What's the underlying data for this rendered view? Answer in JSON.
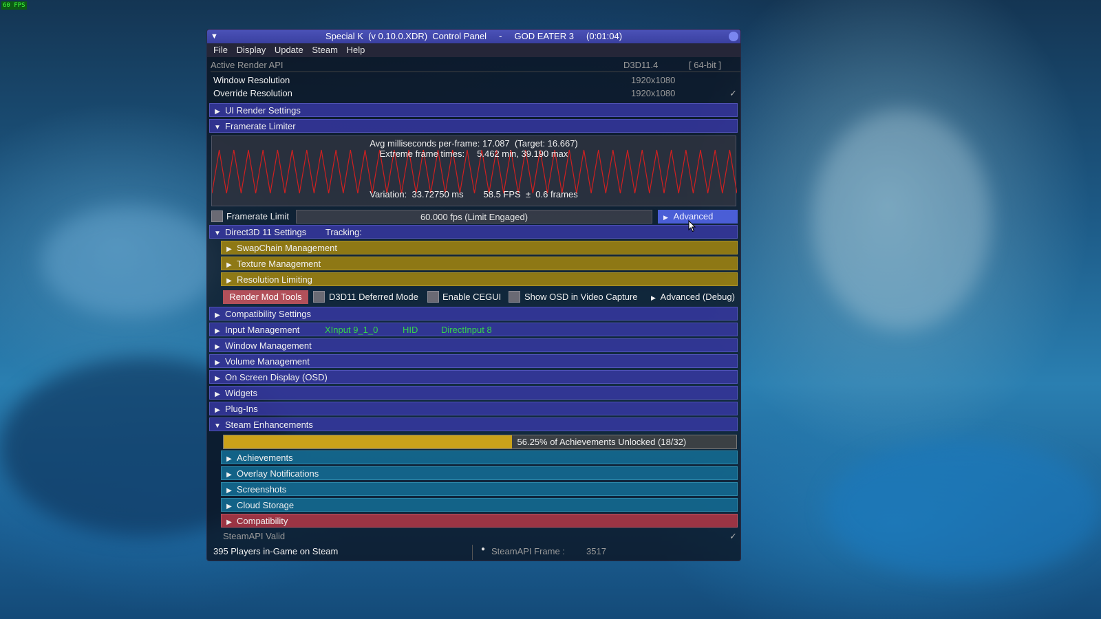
{
  "hud": {
    "fps": "60 FPS"
  },
  "window": {
    "title": "Special K  (v 0.10.0.XDR)  Control Panel     -     GOD EATER 3     (0:01:04)"
  },
  "menu": [
    "File",
    "Display",
    "Update",
    "Steam",
    "Help"
  ],
  "render_api": {
    "label": "Active Render API",
    "value": "D3D11.4",
    "bits": "[ 64-bit ]"
  },
  "window_resolution": {
    "label": "Window Resolution",
    "value": "1920x1080"
  },
  "override_resolution": {
    "label": "Override Resolution",
    "value": "1920x1080",
    "check": "✓"
  },
  "sections": {
    "ui_render": "UI Render Settings",
    "framerate_limiter": "Framerate Limiter",
    "d3d11": "Direct3D 11 Settings",
    "tracking": "Tracking:",
    "swapchain": "SwapChain Management",
    "texture": "Texture Management",
    "resolution_limiting": "Resolution Limiting",
    "compatibility_settings": "Compatibility Settings",
    "input_management": "Input Management",
    "window_management": "Window Management",
    "volume_management": "Volume Management",
    "osd": "On Screen Display (OSD)",
    "widgets": "Widgets",
    "plugins": "Plug-Ins",
    "steam_enhancements": "Steam Enhancements",
    "achievements": "Achievements",
    "overlay_notifications": "Overlay Notifications",
    "screenshots": "Screenshots",
    "cloud_storage": "Cloud Storage",
    "compatibility": "Compatibility"
  },
  "framegraph": {
    "line1": "Avg milliseconds per-frame: 17.087  (Target: 16.667)",
    "line2": "Extreme frame times:     5.462 min, 39.190 max",
    "line3": "Variation:  33.72750 ms        58.5 FPS  ±  0.6 frames",
    "line_color": "#d02020"
  },
  "framerate_limit": {
    "label": "Framerate Limit",
    "slider_text": "60.000 fps  (Limit Engaged)",
    "advanced": "Advanced"
  },
  "d3d11_options": {
    "render_mod_tools": "Render Mod Tools",
    "deferred": "D3D11 Deferred Mode",
    "cegui": "Enable CEGUI",
    "osd_capture": "Show OSD in Video Capture",
    "advanced_debug": "Advanced (Debug)"
  },
  "input_apis": [
    "XInput 9_1_0",
    "HID",
    "DirectInput 8"
  ],
  "achievements": {
    "progress_text": "56.25% of Achievements Unlocked (18/32)",
    "unlocked": 18,
    "total": 32,
    "fraction": 0.5625
  },
  "steamapi": {
    "label": "SteamAPI Valid",
    "check": "✓"
  },
  "footer": {
    "players": "395 Players in-Game on Steam",
    "frame_label": "SteamAPI Frame :",
    "frame_value": "3517"
  },
  "colors": {
    "header_blue": "#3a3aaa",
    "header_gold": "#a5870f",
    "header_teal": "#146e96",
    "header_red": "#af3746",
    "input_green": "#35d54a",
    "achievement_fill": "#caa21a"
  }
}
